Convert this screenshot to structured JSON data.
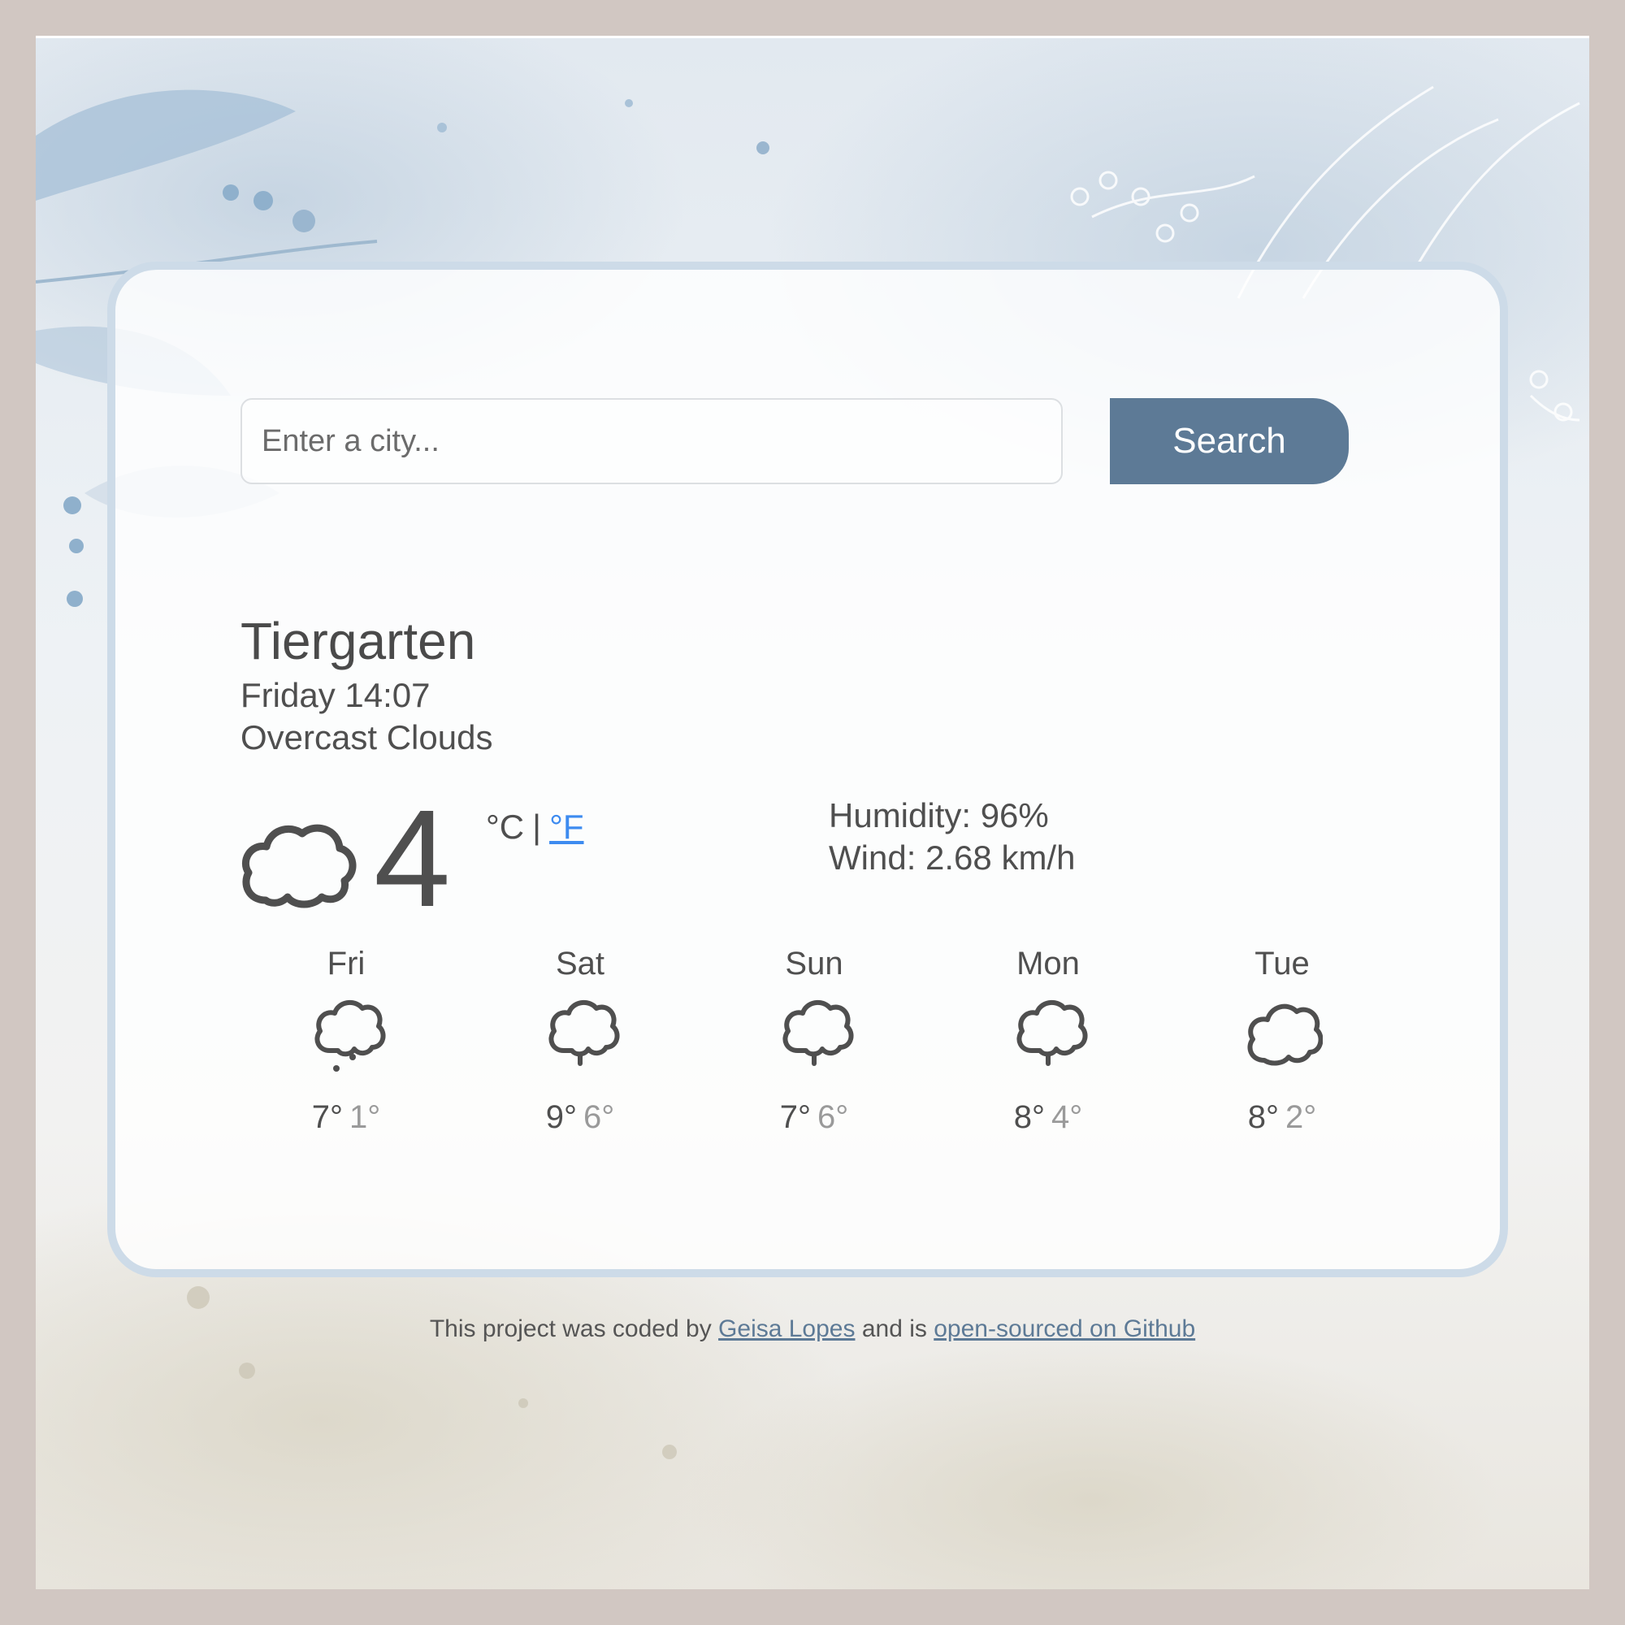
{
  "search": {
    "placeholder": "Enter a city...",
    "button_label": "Search"
  },
  "current": {
    "city": "Tiergarten",
    "datetime": "Friday 14:07",
    "description": "Overcast Clouds",
    "icon": "cloud-icon",
    "temperature": "4",
    "unit_celsius": "°C",
    "unit_separator": "|",
    "unit_fahrenheit": "°F",
    "humidity": "Humidity: 96%",
    "wind": "Wind: 2.68 km/h"
  },
  "forecast": [
    {
      "day": "Fri",
      "icon": "cloud-rain-icon",
      "max": "7°",
      "min": "1°"
    },
    {
      "day": "Sat",
      "icon": "cloud-drizzle-icon",
      "max": "9°",
      "min": "6°"
    },
    {
      "day": "Sun",
      "icon": "cloud-drizzle-icon",
      "max": "7°",
      "min": "6°"
    },
    {
      "day": "Mon",
      "icon": "cloud-drizzle-icon",
      "max": "8°",
      "min": "4°"
    },
    {
      "day": "Tue",
      "icon": "cloud-icon",
      "max": "8°",
      "min": "2°"
    }
  ],
  "footer": {
    "prefix": "This project was coded by",
    "author_link": "Geisa Lopes",
    "middle": "and is",
    "github_link": "open-sourced on Github"
  },
  "colors": {
    "button": "#5d7a96",
    "link_fahrenheit": "#3d8bf0",
    "card_border": "#cddbe8",
    "outer_background": "#d1c7c2"
  }
}
